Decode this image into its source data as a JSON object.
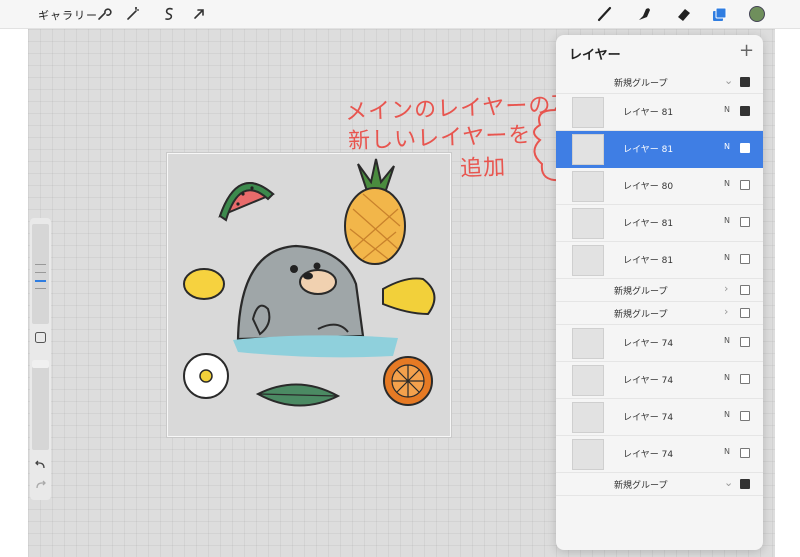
{
  "toolbar": {
    "gallery_label": "ギャラリー",
    "left_icons": [
      "wrench-icon",
      "magic-wand-icon",
      "selection-icon",
      "transform-arrow-icon"
    ],
    "right_icons": [
      "brush-icon",
      "smudge-icon",
      "eraser-icon",
      "layers-icon",
      "color-swatch-icon"
    ],
    "active_color": "#6f8f5c",
    "layers_icon_color": "#2f7de1"
  },
  "annotation": {
    "line1": "メインのレイヤーの下に",
    "line2": "新しいレイヤーを",
    "line3": "追加",
    "color": "#e8554f"
  },
  "layers_panel": {
    "title": "レイヤー",
    "add_label": "+",
    "rows": [
      {
        "type": "group",
        "label": "新規グループ",
        "expanded": true,
        "visible": true
      },
      {
        "type": "layer",
        "label": "レイヤー 81",
        "blend": "N",
        "visible": true,
        "selected": false
      },
      {
        "type": "layer",
        "label": "レイヤー 81",
        "blend": "N",
        "visible": true,
        "selected": true
      },
      {
        "type": "layer",
        "label": "レイヤー 80",
        "blend": "N",
        "visible": false,
        "selected": false
      },
      {
        "type": "layer",
        "label": "レイヤー 81",
        "blend": "N",
        "visible": false,
        "selected": false
      },
      {
        "type": "layer",
        "label": "レイヤー 81",
        "blend": "N",
        "visible": false,
        "selected": false
      },
      {
        "type": "group",
        "label": "新規グループ",
        "expanded": false,
        "visible": false
      },
      {
        "type": "group",
        "label": "新規グループ",
        "expanded": false,
        "visible": false
      },
      {
        "type": "layer",
        "label": "レイヤー 74",
        "blend": "N",
        "visible": false,
        "selected": false
      },
      {
        "type": "layer",
        "label": "レイヤー 74",
        "blend": "N",
        "visible": false,
        "selected": false
      },
      {
        "type": "layer",
        "label": "レイヤー 74",
        "blend": "N",
        "visible": false,
        "selected": false
      },
      {
        "type": "layer",
        "label": "レイヤー 74",
        "blend": "N",
        "visible": false,
        "selected": false
      },
      {
        "type": "group",
        "label": "新規グループ",
        "expanded": true,
        "visible": true
      }
    ]
  },
  "sidebar": {
    "undo_icon": "undo-icon",
    "redo_icon": "redo-icon",
    "modify_icon": "square-modify-icon"
  },
  "canvas": {
    "illustrations": [
      "watermelon",
      "pineapple",
      "lemon",
      "seal",
      "banana",
      "flower",
      "leaf",
      "orange"
    ]
  }
}
